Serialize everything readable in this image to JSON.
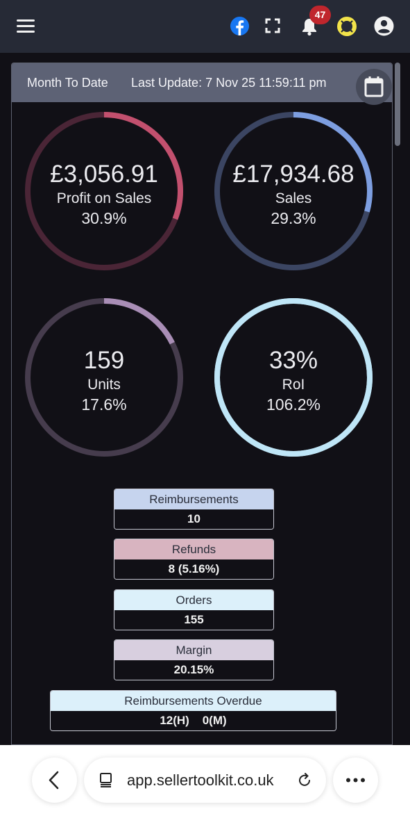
{
  "topbar": {
    "notification_count": "47",
    "icons": [
      "menu-icon",
      "facebook-icon",
      "fullscreen-icon",
      "bell-icon",
      "help-icon",
      "user-icon"
    ]
  },
  "panel": {
    "period": "Month To Date",
    "last_update": "Last Update: 7 Nov 25 11:59:11 pm"
  },
  "gauges": [
    {
      "value": "£3,056.91",
      "label": "Profit on Sales",
      "pct": "30.9%",
      "fill": 0.309,
      "color": "#c2506e",
      "track": "#4a2536"
    },
    {
      "value": "£17,934.68",
      "label": "Sales",
      "pct": "29.3%",
      "fill": 0.293,
      "color": "#7d9ee0",
      "track": "#3b4562"
    },
    {
      "value": "159",
      "label": "Units",
      "pct": "17.6%",
      "fill": 0.176,
      "color": "#a98eb6",
      "track": "#463c4d"
    },
    {
      "value": "33%",
      "label": "RoI",
      "pct": "106.2%",
      "fill": 1.0,
      "color": "#bfe6f7",
      "track": "#bfe6f7"
    }
  ],
  "stats": [
    {
      "label": "Reimbursements",
      "value": "10",
      "color": "#c6d4ee"
    },
    {
      "label": "Refunds",
      "value": "8 (5.16%)",
      "color": "#d8b4c0"
    },
    {
      "label": "Orders",
      "value": "155",
      "color": "#dcf0fa"
    },
    {
      "label": "Margin",
      "value": "20.15%",
      "color": "#d8cfdf"
    },
    {
      "label": "Reimbursements Overdue",
      "value": "12(H)    0(M)",
      "color": "#dcf0fa"
    }
  ],
  "browser": {
    "url": "app.sellertoolkit.co.uk",
    "icons": [
      "back-icon",
      "tabs-icon",
      "reload-icon",
      "more-icon"
    ]
  }
}
